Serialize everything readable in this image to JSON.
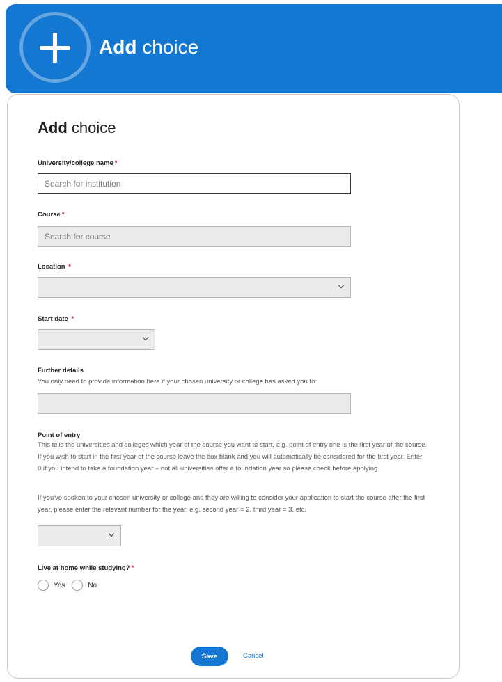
{
  "header": {
    "title_bold": "Add",
    "title_rest": " choice",
    "icon": "plus-icon"
  },
  "form": {
    "title_bold": "Add",
    "title_rest": " choice",
    "institution": {
      "label": "University/college name",
      "required": "*",
      "placeholder": "Search for institution"
    },
    "course": {
      "label": "Course",
      "required": "*",
      "placeholder": "Search for course"
    },
    "location": {
      "label": "Location",
      "required": "*",
      "value": ""
    },
    "start_date": {
      "label": "Start date",
      "required": "*",
      "value": ""
    },
    "further_details": {
      "label": "Further details",
      "help": "You only need to provide information here if your chosen university or college has asked you to.",
      "value": ""
    },
    "point_of_entry": {
      "label": "Point of entry",
      "help1": "This tells the universities and colleges which year of the course you want to start, e.g. point of entry one is the first year of the course. If you wish to start in the first year of the course leave the box blank and you will automatically be considered for the first year. Enter 0 if you intend to take a foundation year – not all universities offer a foundation year so please check before applying.",
      "help2": "If you've spoken to your chosen university or college and they are willing to consider your application to start the course after the first year, please enter the relevant number for the year, e.g. second year = 2, third year = 3, etc.",
      "value": ""
    },
    "live_at_home": {
      "label": "Live at home while studying?",
      "required": "*",
      "options": [
        "Yes",
        "No"
      ]
    },
    "save_label": "Save",
    "cancel_label": "Cancel"
  },
  "colors": {
    "primary": "#1477d1",
    "required": "#d4213d"
  }
}
